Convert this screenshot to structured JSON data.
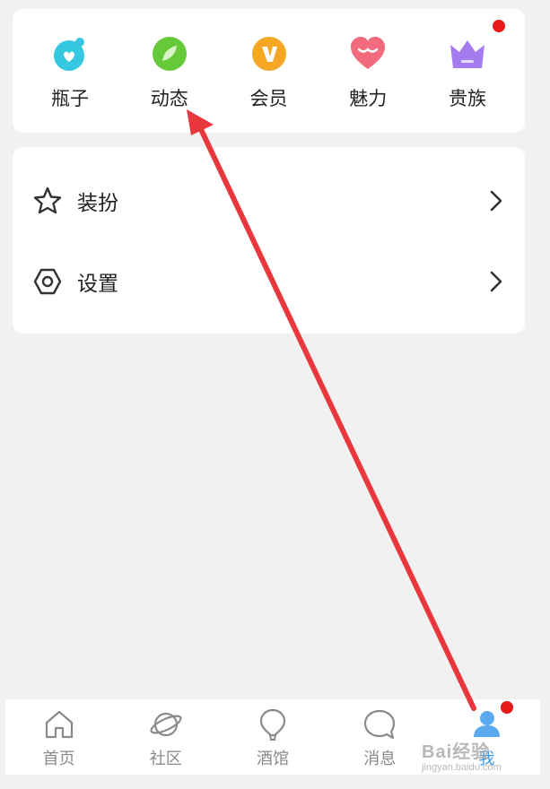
{
  "quick_entries": [
    {
      "label": "瓶子",
      "icon": "bottle-icon",
      "color": "#35c8e0"
    },
    {
      "label": "动态",
      "icon": "moments-icon",
      "color": "#66c93a"
    },
    {
      "label": "会员",
      "icon": "vip-icon",
      "color": "#f5a623"
    },
    {
      "label": "魅力",
      "icon": "heart-icon",
      "color": "#f26a7e"
    },
    {
      "label": "贵族",
      "icon": "crown-icon",
      "color": "#a47cf0",
      "has_red_dot": true
    }
  ],
  "menu": [
    {
      "label": "装扮",
      "icon": "star-icon"
    },
    {
      "label": "设置",
      "icon": "settings-icon"
    }
  ],
  "tabbar": [
    {
      "label": "首页",
      "icon": "home-icon"
    },
    {
      "label": "社区",
      "icon": "planet-icon"
    },
    {
      "label": "酒馆",
      "icon": "balloon-icon"
    },
    {
      "label": "消息",
      "icon": "message-icon"
    },
    {
      "label": "我",
      "icon": "profile-icon",
      "active": true,
      "has_red_dot": true
    }
  ],
  "colors": {
    "background": "#f2f1f2",
    "active_tab": "#3d9be9",
    "notification_dot": "#e81919",
    "annotation_arrow": "#e8383d"
  },
  "watermark": {
    "text": "Bai经验",
    "sub": "jingyan.baidu.com"
  }
}
